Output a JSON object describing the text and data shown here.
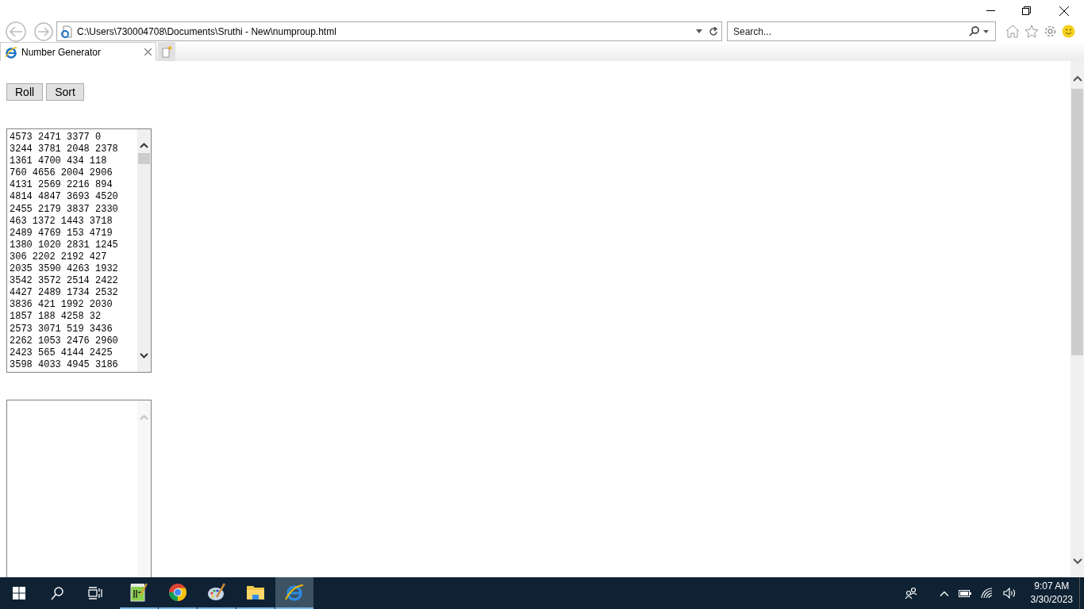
{
  "browser": {
    "address": "C:\\Users\\730004708\\Documents\\Sruthi - New\\numproup.html",
    "search_placeholder": "Search...",
    "tabs": [
      {
        "label": "Number Generator",
        "selected": true
      }
    ]
  },
  "page": {
    "buttons": [
      "Roll",
      "Sort"
    ],
    "numbers_box": {
      "lines": [
        "4573 2471 3377 0",
        "3244 3781 2048 2378",
        "1361 4700 434 118",
        "760 4656 2004 2906",
        "4131 2569 2216 894",
        "4814 4847 3693 4520",
        "2455 2179 3837 2330",
        "463 1372 1443 3718",
        "2489 4769 153 4719",
        "1380 1020 2831 1245",
        "306 2202 2192 427",
        "2035 3590 4263 1932",
        "3542 3572 2514 2422",
        "4427 2489 1734 2532",
        "3836 421 1992 2030",
        "1857 188 4258 32",
        "2573 3071 519 3436",
        "2262 1053 2476 2960",
        "2423 565 4144 2425",
        "3598 4033 4945 3186"
      ]
    }
  },
  "taskbar": {
    "apps": [
      {
        "kind": "notepad",
        "selected": false
      },
      {
        "kind": "chrome",
        "selected": false
      },
      {
        "kind": "paint",
        "selected": false
      },
      {
        "kind": "explorer",
        "selected": false
      },
      {
        "kind": "ie",
        "selected": true
      }
    ],
    "time": "9:07 AM",
    "date": "3/30/2023"
  }
}
